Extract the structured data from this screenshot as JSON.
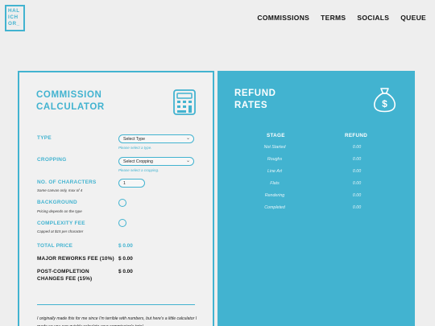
{
  "logo": {
    "lines": [
      "HAL",
      "ICH",
      "OR_"
    ]
  },
  "nav": [
    {
      "label": "COMMISSIONS"
    },
    {
      "label": "TERMS"
    },
    {
      "label": "SOCIALS"
    },
    {
      "label": "QUEUE"
    }
  ],
  "calculator": {
    "title_line1": "COMMISSION",
    "title_line2": "CALCULATOR",
    "icon": "calculator-icon",
    "type": {
      "label": "TYPE",
      "selected": "Select Type",
      "help": "Please select a type."
    },
    "cropping": {
      "label": "CROPPING",
      "selected": "Select Cropping",
      "help": "Please select a cropping."
    },
    "characters": {
      "label": "NO. OF CHARACTERS",
      "sub": "Same canvas only, max of 4",
      "value": "1"
    },
    "background": {
      "label": "BACKGROUND",
      "sub": "Pricing depends on the type"
    },
    "complexity": {
      "label": "COMPLEXITY FEE",
      "sub": "Capped at $15 per character"
    },
    "total_price": {
      "label": "TOTAL PRICE",
      "value": "$ 0.00"
    },
    "major_reworks": {
      "label": "MAJOR REWORKS FEE (10%)",
      "value": "$ 0.00"
    },
    "post_completion": {
      "label_line1": "POST-COMPLETION",
      "label_line2": "CHANGES FEE (15%)",
      "value": "$ 0.00"
    },
    "note": "I originally made this for me since I'm terrible with numbers, but here's a little calculator I made so you can quickly calculate your commission's total"
  },
  "refund": {
    "title_line1": "REFUND",
    "title_line2": "RATES",
    "icon": "money-bag-icon",
    "headers": {
      "stage": "STAGE",
      "refund": "REFUND"
    },
    "rows": [
      {
        "stage": "Not Started",
        "refund": "0.00"
      },
      {
        "stage": "Roughs",
        "refund": "0.00"
      },
      {
        "stage": "Line Art",
        "refund": "0.00"
      },
      {
        "stage": "Flats",
        "refund": "0.00"
      },
      {
        "stage": "Rendering",
        "refund": "0.00"
      },
      {
        "stage": "Completed",
        "refund": "0.00"
      }
    ]
  },
  "colors": {
    "accent": "#42b3d0",
    "background": "#eeeeee"
  }
}
